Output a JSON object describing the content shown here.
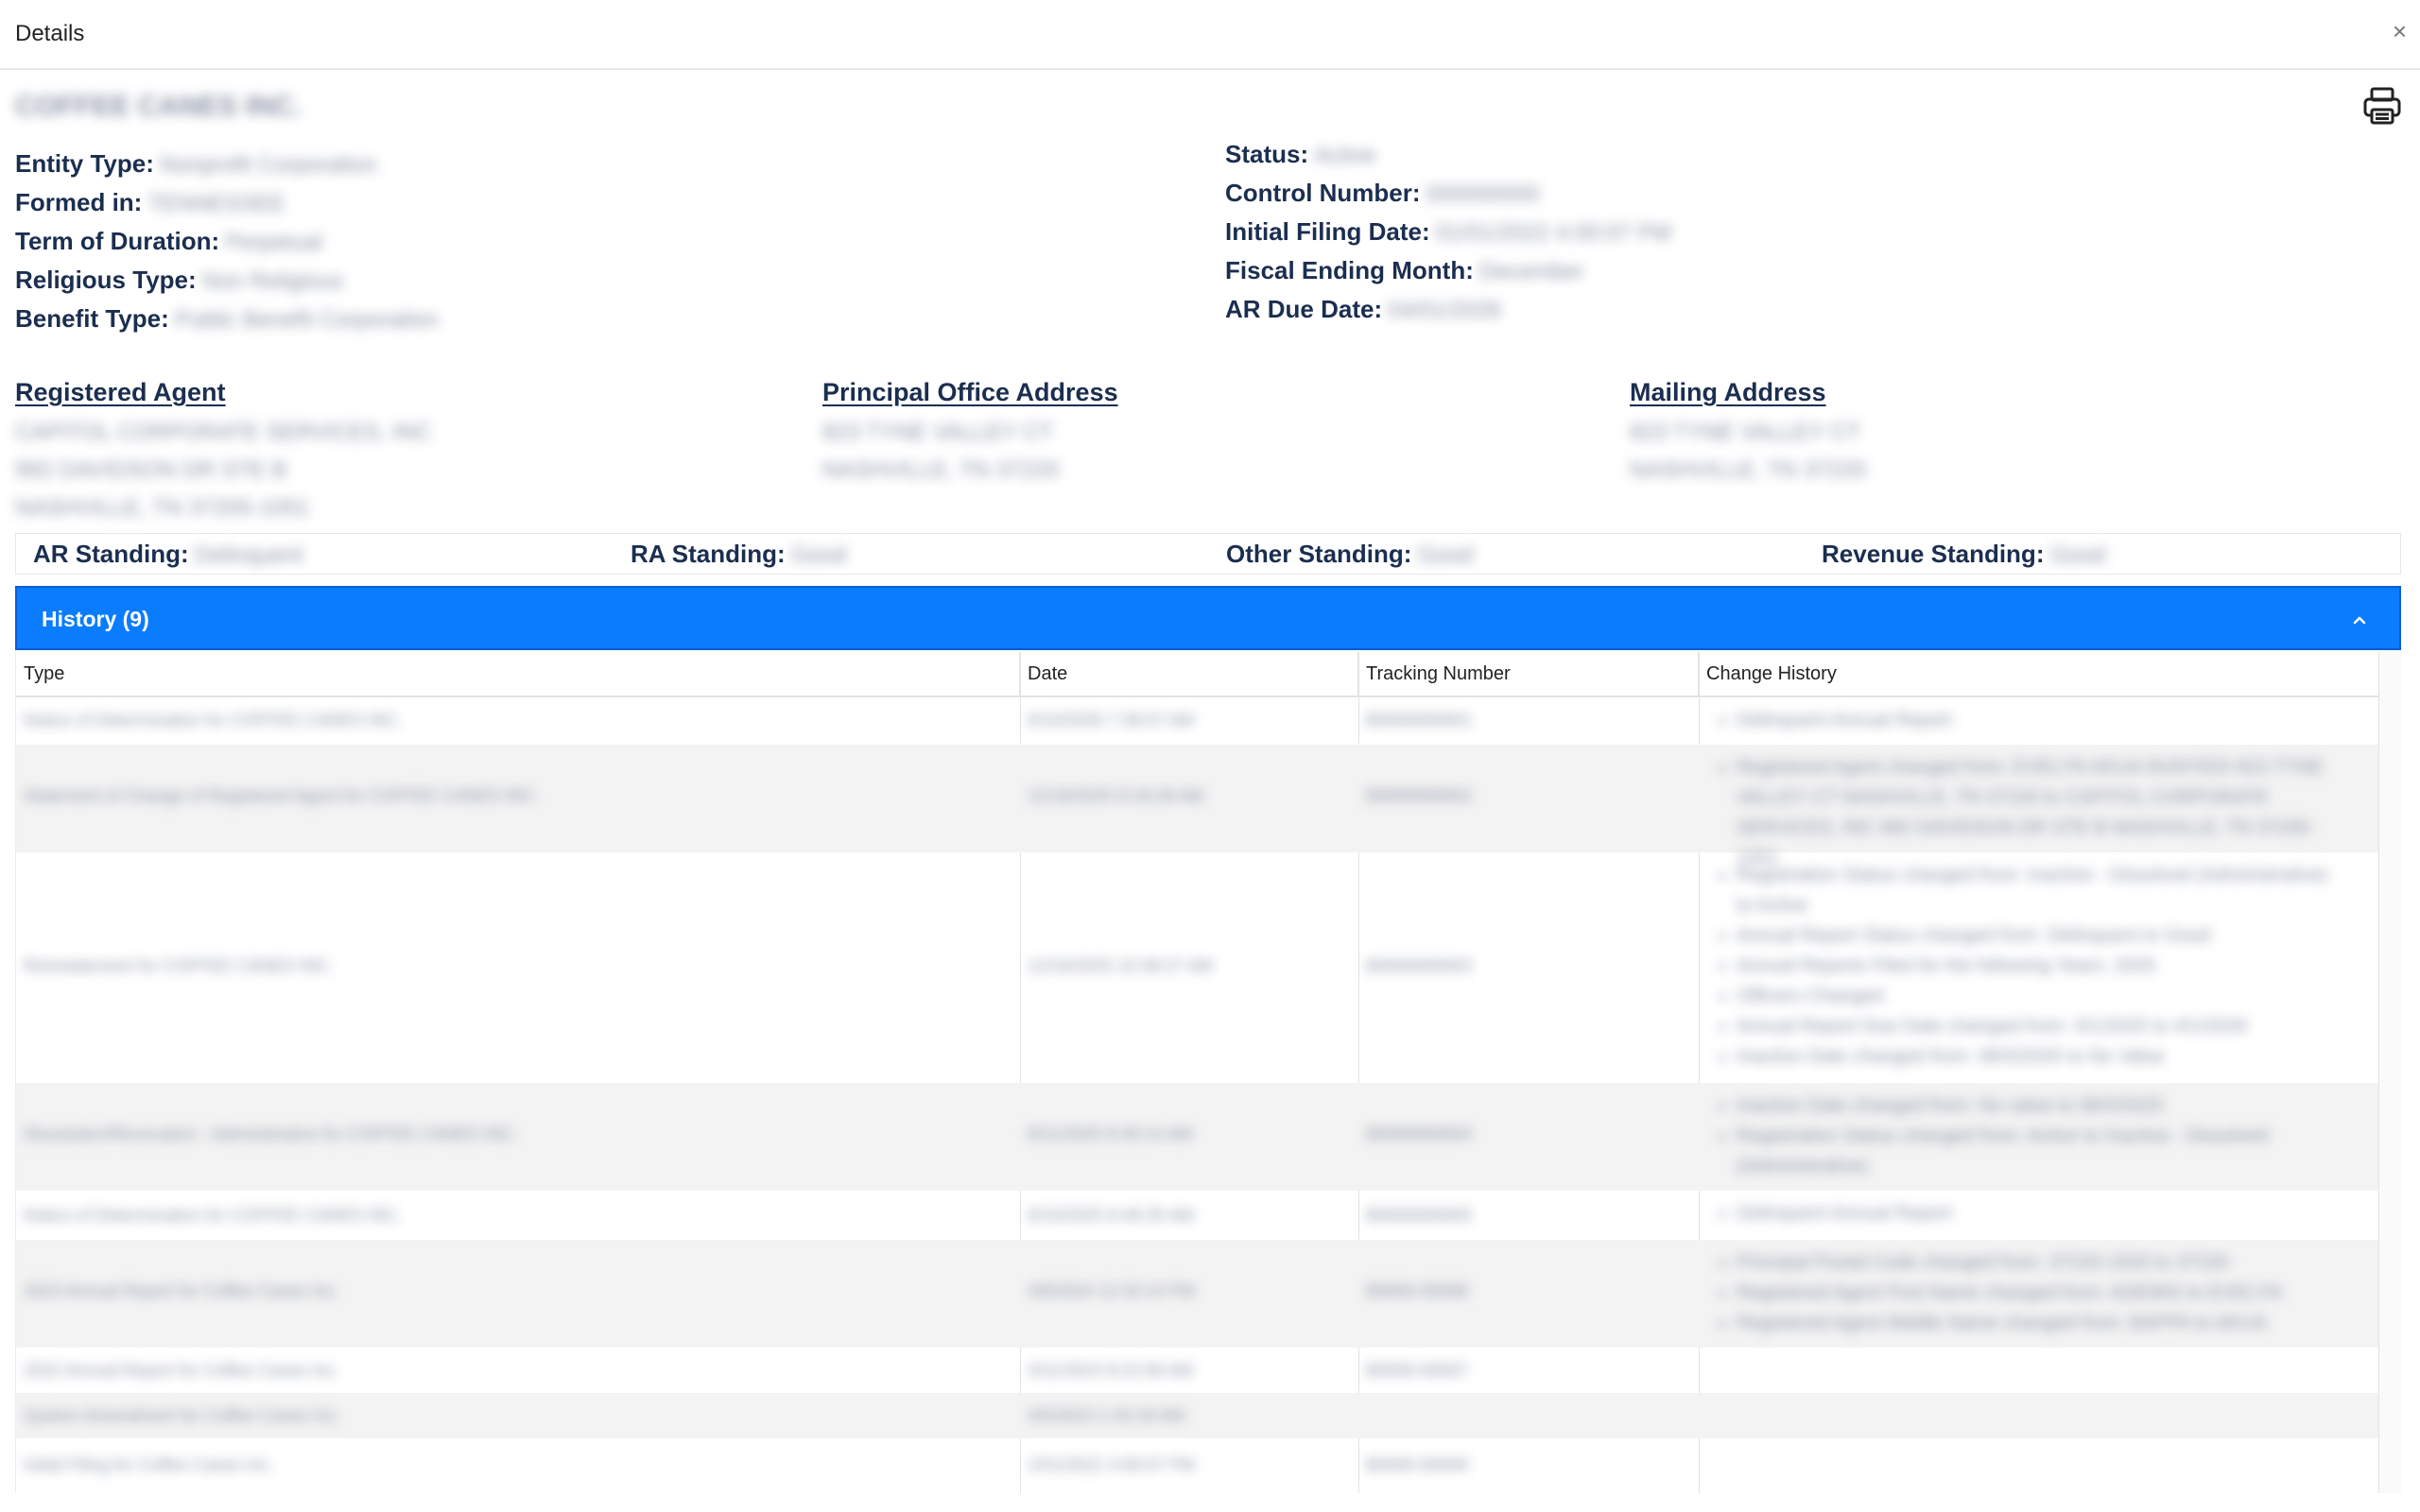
{
  "header": {
    "title": "Details",
    "close_label": "×"
  },
  "entity": {
    "name": "COFFEE CANES INC."
  },
  "left_fields": [
    {
      "label": "Entity Type:",
      "value": "Nonprofit Corporation"
    },
    {
      "label": "Formed in:",
      "value": "TENNESSEE"
    },
    {
      "label": "Term of Duration:",
      "value": "Perpetual"
    },
    {
      "label": "Religious Type:",
      "value": "Non Religious"
    },
    {
      "label": "Benefit Type:",
      "value": "Public Benefit Corporation"
    }
  ],
  "right_fields": [
    {
      "label": "Status:",
      "value": "Active"
    },
    {
      "label": "Control Number:",
      "value": "000000000"
    },
    {
      "label": "Initial Filing Date:",
      "value": "01/01/2022 4:00:07 PM"
    },
    {
      "label": "Fiscal Ending Month:",
      "value": "December"
    },
    {
      "label": "AR Due Date:",
      "value": "04/01/2026"
    }
  ],
  "addresses": {
    "registered_agent": {
      "title": "Registered Agent",
      "lines": [
        "CAPITOL CORPORATE SERVICES, INC",
        "992 DAVIDSON DR STE B",
        "NASHVILLE, TN 37205-1051"
      ]
    },
    "principal_office": {
      "title": "Principal Office Address",
      "lines": [
        "823 TYNE VALLEY CT",
        "NASHVILLE, TN 37220"
      ]
    },
    "mailing": {
      "title": "Mailing Address",
      "lines": [
        "823 TYNE VALLEY CT",
        "NASHVILLE, TN 37220"
      ]
    }
  },
  "standings": [
    {
      "label": "AR Standing:",
      "value": "Delinquent"
    },
    {
      "label": "RA Standing:",
      "value": "Good"
    },
    {
      "label": "Other Standing:",
      "value": "Good"
    },
    {
      "label": "Revenue Standing:",
      "value": "Good"
    }
  ],
  "history": {
    "title": "History (9)",
    "columns": [
      "Type",
      "Date",
      "Tracking Number",
      "Change History"
    ],
    "rows": [
      {
        "type": "Notice of Determination for COFFEE CANES INC.",
        "date": "6/10/2026 7:38:07 AM",
        "tracking": "B0000000001",
        "changes": [
          "Delinquent Annual Report"
        ]
      },
      {
        "type": "Statement of Change of Registered Agent for COFFEE CANES INC.",
        "date": "12/18/2025 8:18:28 AM",
        "tracking": "B0000000002",
        "changes": [
          "Registered Agent changed from: EVELYN AKUA NUNYEDI 823 TYNE VALLEY CT NASHVILLE, TN 37220 to CAPITOL CORPORATE SERVICES, INC 992 DAVIDSON DR STE B NASHVILLE, TN 37205-1051"
        ]
      },
      {
        "type": "Reinstatement for COFFEE CANES INC.",
        "date": "12/16/2025 10:38:27 AM",
        "tracking": "B0000000003",
        "changes": [
          "Registration Status changed from: Inactive - Dissolved (Administrative) to Active",
          "Annual Report Status changed from: Delinquent to Good",
          "Annual Reports Filed for the following Years: 2025",
          "Officers Changed",
          "Annual Report Due Date changed from: 4/1/2025 to 4/1/2026",
          "Inactive Date changed from: 08/3/2025 to No Value"
        ]
      },
      {
        "type": "Dissolution/Revocation - Administrative for COFFEE CANES INC.",
        "date": "8/11/2025 8:30:14 AM",
        "tracking": "B0000000004",
        "changes": [
          "Inactive Date changed from: No value to 08/3/2025",
          "Registration Status changed from: Active to Inactive - Dissolved (Administrative)"
        ]
      },
      {
        "type": "Notice of Determination for COFFEE CANES INC.",
        "date": "6/10/2025 8:48:35 AM",
        "tracking": "B0000000005",
        "changes": [
          "Delinquent Annual Report"
        ]
      },
      {
        "type": "2023 Annual Report for Coffee Canes Inc.",
        "date": "4/8/2024 12:32:14 PM",
        "tracking": "B0000-00006",
        "changes": [
          "Principal Postal Code changed from: 37220-1533 to 37220",
          "Registered Agent First Name changed from: ADEMIS to EVELYN",
          "Registered Agent Middle Name changed from: BAPPA to AKUA"
        ]
      },
      {
        "type": "2022 Annual Report for Coffee Canes Inc.",
        "date": "4/11/2023 8:22:06 AM",
        "tracking": "B0000-00007",
        "changes": []
      },
      {
        "type": "System Amendment for Coffee Canes Inc.",
        "date": "4/5/2023 1:43:18 AM",
        "tracking": "",
        "changes": []
      },
      {
        "type": "Initial Filing for Coffee Canes Inc.",
        "date": "1/01/2022 4:00:07 PM",
        "tracking": "B0000-00009",
        "changes": []
      }
    ]
  },
  "colors": {
    "accent": "#0a7cfd",
    "label_navy": "#1b2e50"
  }
}
